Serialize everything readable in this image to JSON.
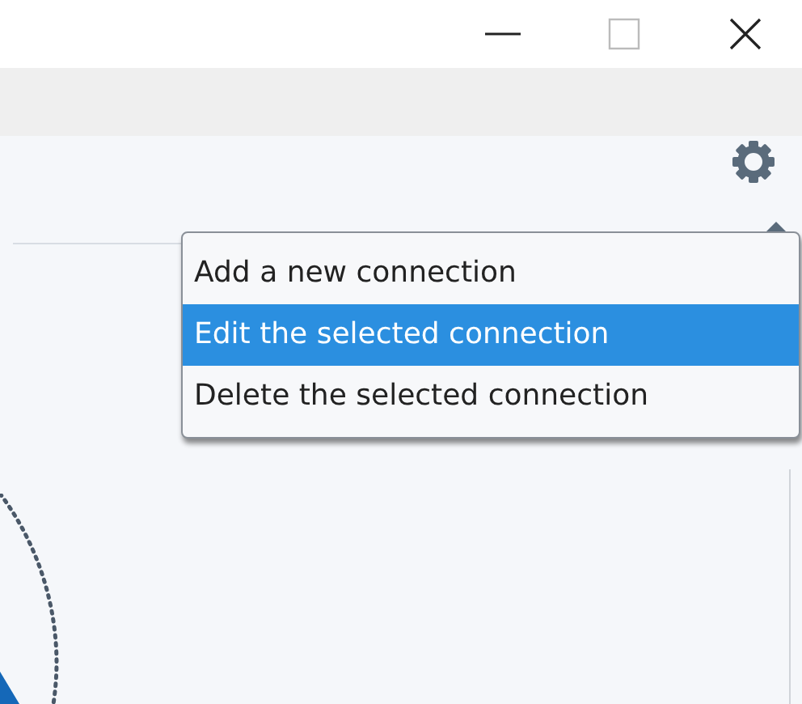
{
  "window_controls": [
    {
      "kind": "minimize"
    },
    {
      "kind": "maximize"
    },
    {
      "kind": "close"
    }
  ],
  "settings_menu": {
    "expanded": true,
    "items": [
      {
        "label": "Add a new connection",
        "selected": false
      },
      {
        "label": "Edit the selected connection",
        "selected": true
      },
      {
        "label": "Delete the selected connection",
        "selected": false
      }
    ]
  }
}
